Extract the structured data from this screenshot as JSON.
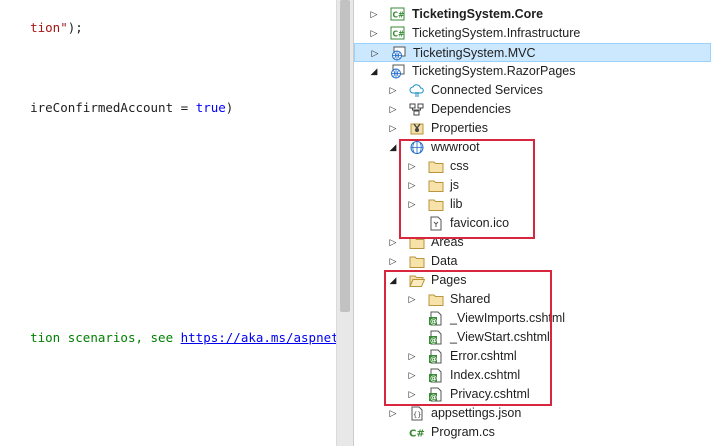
{
  "editor": {
    "lines": [
      {
        "segments": [
          {
            "t": "tion\"",
            "c": "str"
          },
          {
            "t": ");",
            "c": ""
          }
        ]
      },
      {
        "segments": [
          {
            "t": "ireConfirmedAccount = ",
            "c": ""
          },
          {
            "t": "true",
            "c": "kw"
          },
          {
            "t": ")",
            "c": ""
          }
        ]
      },
      {
        "segments": [
          {
            "t": "tion scenarios, see ",
            "c": "cmt"
          },
          {
            "t": "https://aka.ms/aspnetcore-",
            "c": "lnk"
          }
        ]
      }
    ]
  },
  "explorer": {
    "items": [
      {
        "label": "TicketingSystem.Core",
        "icon": "csharp-project-icon",
        "arrow": "collapsed",
        "bold": true
      },
      {
        "label": "TicketingSystem.Infrastructure",
        "icon": "csharp-project-icon",
        "arrow": "collapsed",
        "bold": false
      },
      {
        "label": "TicketingSystem.MVC",
        "icon": "web-project-icon",
        "arrow": "collapsed",
        "bold": false,
        "selected": true
      },
      {
        "label": "TicketingSystem.RazorPages",
        "icon": "web-project-icon",
        "arrow": "expanded",
        "bold": false
      },
      {
        "label": "Connected Services",
        "icon": "connected-services-icon",
        "arrow": "collapsed"
      },
      {
        "label": "Dependencies",
        "icon": "dependencies-icon",
        "arrow": "collapsed"
      },
      {
        "label": "Properties",
        "icon": "properties-icon",
        "arrow": "collapsed"
      },
      {
        "label": "wwwroot",
        "icon": "globe-icon",
        "arrow": "expanded"
      },
      {
        "label": "css",
        "icon": "folder-icon",
        "arrow": "collapsed"
      },
      {
        "label": "js",
        "icon": "folder-icon",
        "arrow": "collapsed"
      },
      {
        "label": "lib",
        "icon": "folder-icon",
        "arrow": "collapsed"
      },
      {
        "label": "favicon.ico",
        "icon": "file-icon",
        "arrow": "none"
      },
      {
        "label": "Areas",
        "icon": "folder-icon",
        "arrow": "collapsed"
      },
      {
        "label": "Data",
        "icon": "folder-icon",
        "arrow": "collapsed"
      },
      {
        "label": "Pages",
        "icon": "folder-open-icon",
        "arrow": "expanded"
      },
      {
        "label": "Shared",
        "icon": "folder-icon",
        "arrow": "collapsed"
      },
      {
        "label": "_ViewImports.cshtml",
        "icon": "razor-file-icon",
        "arrow": "none"
      },
      {
        "label": "_ViewStart.cshtml",
        "icon": "razor-file-icon",
        "arrow": "none"
      },
      {
        "label": "Error.cshtml",
        "icon": "razor-file-icon",
        "arrow": "collapsed"
      },
      {
        "label": "Index.cshtml",
        "icon": "razor-file-icon",
        "arrow": "collapsed"
      },
      {
        "label": "Privacy.cshtml",
        "icon": "razor-file-icon",
        "arrow": "collapsed"
      },
      {
        "label": "appsettings.json",
        "icon": "json-file-icon",
        "arrow": "collapsed"
      },
      {
        "label": "Program.cs",
        "icon": "csharp-file-icon",
        "arrow": "none",
        "iconText": "C#"
      }
    ]
  },
  "colors": {
    "highlight_box": "#d7263d",
    "selection": "#cce8ff",
    "folder": "#dcb67a",
    "csharp": "#388a34"
  }
}
